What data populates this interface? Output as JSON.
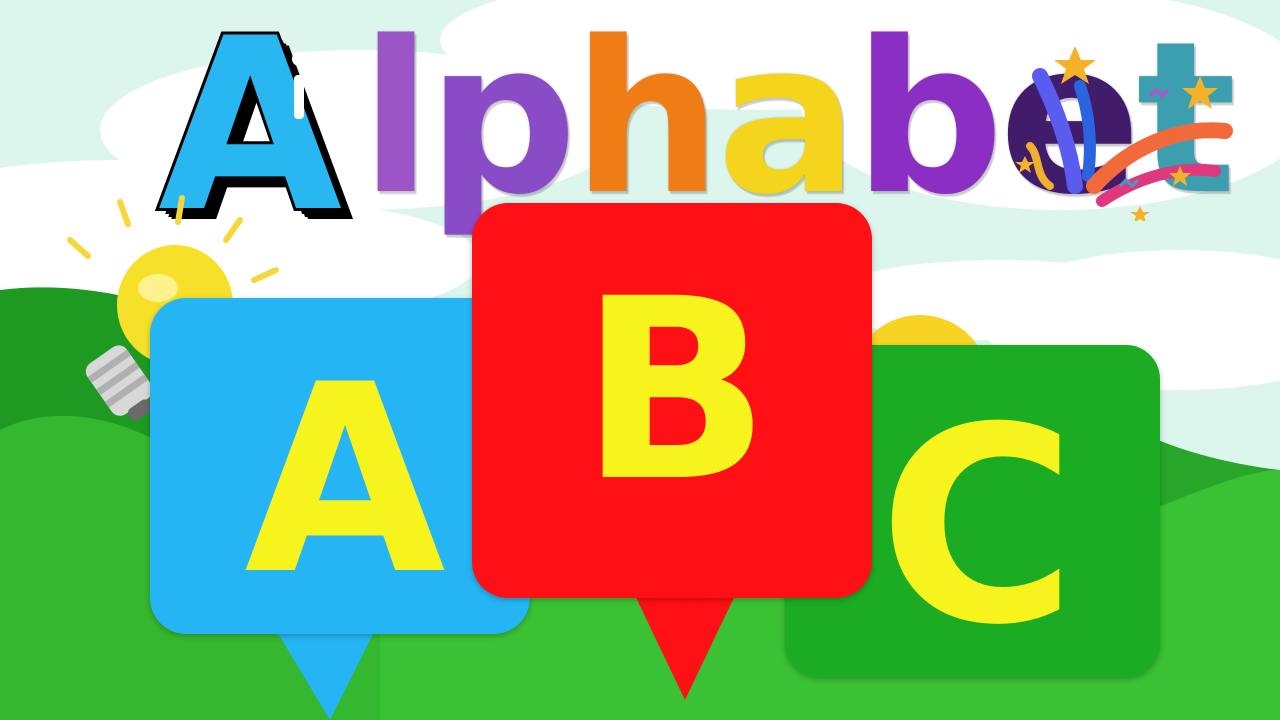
{
  "title": {
    "big_letter": "A",
    "word": [
      "l",
      "p",
      "h",
      "a",
      "b",
      "e",
      "t"
    ],
    "big_letter_color": "#29b7f2",
    "word_colors": [
      "#9b55c7",
      "#8a4cc6",
      "#f07c16",
      "#f4d51c",
      "#8b2fc4",
      "#401c6b",
      "#3b9fb0"
    ]
  },
  "bubbles": [
    {
      "letter": "A",
      "color": "#26b5f4"
    },
    {
      "letter": "B",
      "color": "#ff1014"
    },
    {
      "letter": "C",
      "color": "#1bac24"
    }
  ],
  "letter_color": "#f7f31c",
  "decor": {
    "bulb_icon": "light-bulb-icon",
    "confetti_icon": "party-popper-icon"
  }
}
